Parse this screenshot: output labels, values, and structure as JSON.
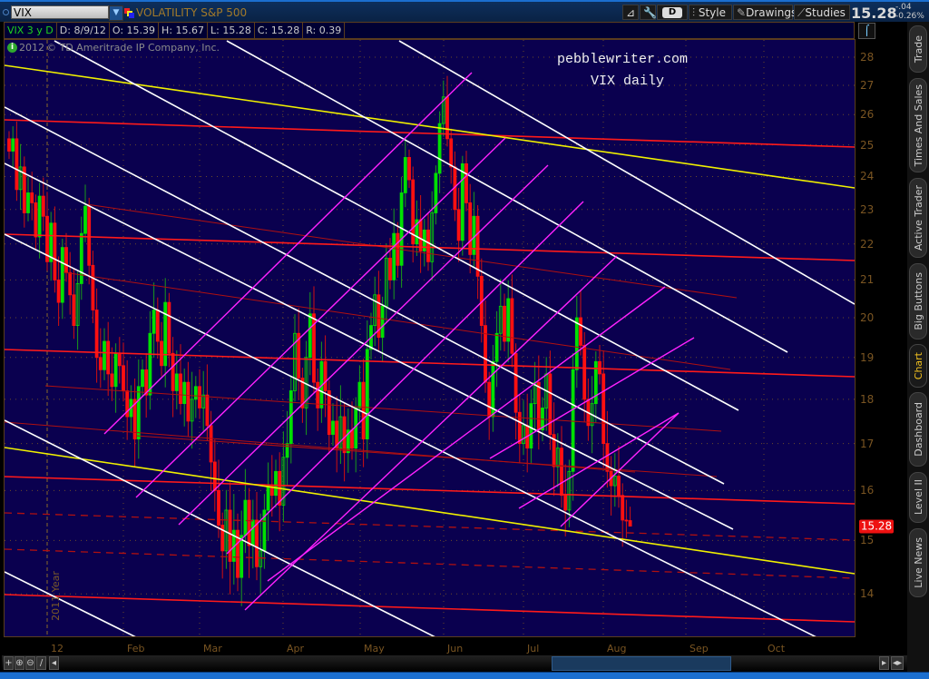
{
  "header": {
    "symbol": "VIX",
    "company": "VOLATILITY S&P 500",
    "buttons": {
      "period": "D",
      "style": "Style",
      "drawings": "Drawings",
      "studies": "Studies"
    },
    "last_price": "15.28",
    "change": "-.04",
    "change_pct": "-0.26%"
  },
  "infobar": {
    "symbol_period": "VIX 3 y D",
    "date": "D: 8/9/12",
    "open": "O: 15.39",
    "high": "H: 15.67",
    "low": "L: 15.28",
    "close": "C: 15.28",
    "range": "R: 0.39"
  },
  "copyright": {
    "year": "2012",
    "text": "© TD Ameritrade IP Company, Inc."
  },
  "watermark": {
    "line1": "pebblewriter.com",
    "line2": "VIX daily"
  },
  "year_marker": "2011 Year",
  "price_badge": "15.28",
  "side_tabs": [
    {
      "label": "Trade",
      "active": false
    },
    {
      "label": "Times And Sales",
      "active": false
    },
    {
      "label": "Active Trader",
      "active": false
    },
    {
      "label": "Big Buttons",
      "active": false
    },
    {
      "label": "Chart",
      "active": true
    },
    {
      "label": "Dashboard",
      "active": false
    },
    {
      "label": "Level II",
      "active": false
    },
    {
      "label": "Live News",
      "active": false
    }
  ],
  "colors": {
    "background": "#0a004f",
    "up": "#00e000",
    "down": "#ff1010",
    "trend_white": "#ffffff",
    "trend_magenta": "#ff22ff",
    "trend_red": "#ff1a1a",
    "trend_darkred": "#b01010",
    "trend_yellow": "#f0f000"
  },
  "chart_data": {
    "type": "candlestick",
    "title": "VOLATILITY S&P 500",
    "symbol": "VIX",
    "scale": "log",
    "ylim": [
      13.5,
      28.5
    ],
    "y_ticks": [
      "28",
      "27",
      "26",
      "25",
      "24",
      "23",
      "22",
      "21",
      "20",
      "19",
      "18",
      "17",
      "16",
      "15",
      "14"
    ],
    "x_ticks": [
      "12",
      "Feb",
      "Mar",
      "Apr",
      "May",
      "Jun",
      "Jul",
      "Aug",
      "Sep",
      "Oct"
    ],
    "grid": true,
    "closes": [
      24.8,
      25.2,
      23.6,
      24.3,
      22.9,
      23.5,
      23.2,
      22.2,
      23.4,
      22.8,
      21.5,
      22.6,
      21.0,
      20.4,
      21.9,
      21.2,
      20.6,
      19.8,
      20.9,
      22.3,
      23.1,
      21.4,
      20.2,
      19.0,
      18.7,
      19.4,
      18.6,
      18.3,
      19.1,
      18.8,
      18.2,
      17.6,
      18.0,
      17.1,
      18.3,
      18.7,
      18.1,
      19.6,
      20.2,
      19.4,
      18.8,
      20.4,
      19.1,
      18.2,
      18.6,
      17.9,
      18.4,
      17.5,
      18.0,
      18.3,
      17.8,
      18.1,
      17.4,
      16.6,
      16.0,
      15.3,
      14.8,
      15.6,
      14.6,
      15.2,
      14.3,
      15.1,
      15.8,
      14.9,
      15.4,
      14.5,
      14.8,
      15.6,
      16.1,
      15.9,
      16.4,
      15.7,
      16.7,
      17.0,
      18.2,
      19.6,
      18.5,
      17.8,
      19.0,
      20.1,
      18.4,
      17.8,
      18.9,
      18.2,
      17.2,
      17.5,
      16.9,
      17.6,
      16.8,
      17.3,
      16.9,
      17.8,
      18.4,
      17.1,
      19.2,
      19.8,
      20.6,
      19.5,
      20.3,
      21.6,
      21.0,
      22.3,
      21.4,
      23.5,
      24.6,
      23.9,
      22.0,
      22.7,
      21.8,
      22.4,
      21.5,
      22.9,
      24.1,
      25.7,
      26.6,
      25.2,
      24.3,
      23.0,
      22.1,
      24.4,
      23.2,
      21.7,
      22.8,
      21.1,
      19.8,
      18.4,
      17.6,
      18.9,
      19.6,
      20.3,
      19.4,
      20.5,
      19.1,
      17.7,
      17.0,
      17.4,
      16.9,
      17.9,
      18.4,
      17.3,
      17.8,
      18.6,
      17.2,
      16.5,
      16.9,
      15.9,
      15.6,
      16.4,
      18.7,
      20.0,
      19.3,
      18.0,
      17.4,
      17.9,
      18.9,
      18.6,
      17.0,
      16.4,
      16.1,
      16.3,
      15.9,
      15.4,
      15.39,
      15.28
    ],
    "last_bar": {
      "date": "8/9/12",
      "open": 15.39,
      "high": 15.67,
      "low": 15.28,
      "close": 15.28
    }
  }
}
